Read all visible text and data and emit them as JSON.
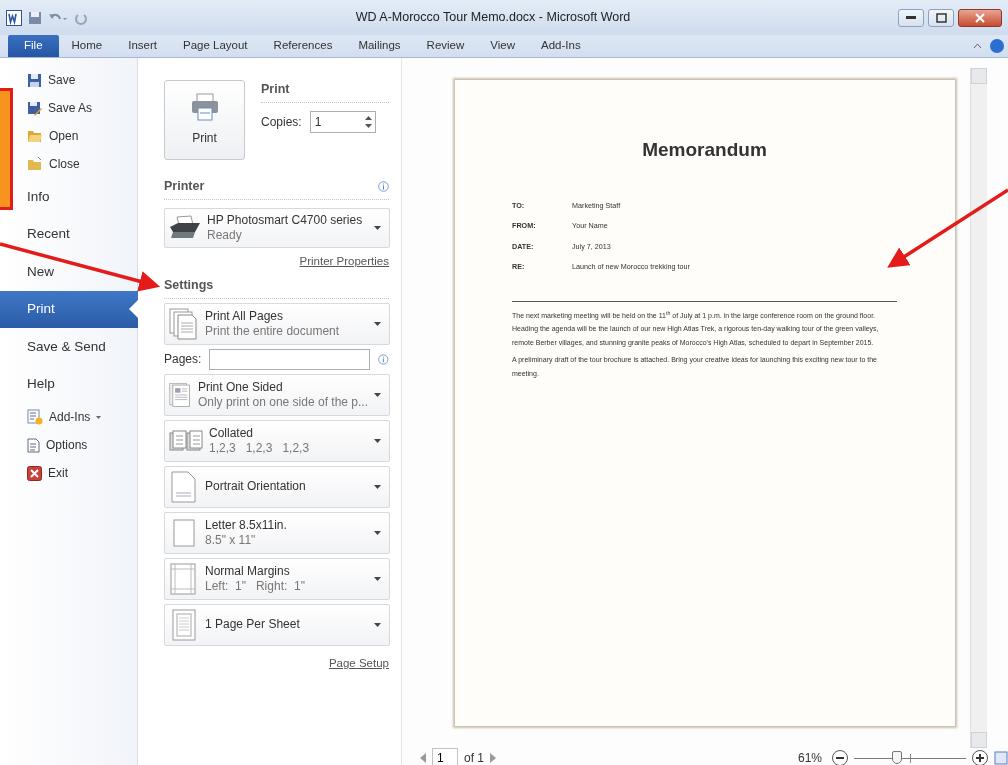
{
  "window": {
    "title": "WD A-Morocco Tour Memo.docx  -  Microsoft Word"
  },
  "ribbon_tabs": [
    {
      "label": "File",
      "selected": true
    },
    {
      "label": "Home",
      "selected": false
    },
    {
      "label": "Insert",
      "selected": false
    },
    {
      "label": "Page Layout",
      "selected": false
    },
    {
      "label": "References",
      "selected": false
    },
    {
      "label": "Mailings",
      "selected": false
    },
    {
      "label": "Review",
      "selected": false
    },
    {
      "label": "View",
      "selected": false
    },
    {
      "label": "Add-Ins",
      "selected": false
    }
  ],
  "backstage_menu": [
    {
      "label": "Save",
      "kind": "command",
      "selected": false
    },
    {
      "label": "Save As",
      "kind": "command",
      "selected": false
    },
    {
      "label": "Open",
      "kind": "command",
      "selected": false
    },
    {
      "label": "Close",
      "kind": "command",
      "selected": false
    },
    {
      "label": "Info",
      "kind": "section",
      "selected": false
    },
    {
      "label": "Recent",
      "kind": "section",
      "selected": false
    },
    {
      "label": "New",
      "kind": "section",
      "selected": false
    },
    {
      "label": "Print",
      "kind": "section",
      "selected": true
    },
    {
      "label": "Save & Send",
      "kind": "section",
      "selected": false
    },
    {
      "label": "Help",
      "kind": "section",
      "selected": false
    },
    {
      "label": "Add-Ins",
      "kind": "menu",
      "selected": false
    },
    {
      "label": "Options",
      "kind": "command",
      "selected": false
    },
    {
      "label": "Exit",
      "kind": "command",
      "selected": false
    }
  ],
  "print": {
    "button_label": "Print",
    "heading": "Print",
    "copies_label": "Copies:",
    "copies_value": "1"
  },
  "printer": {
    "heading": "Printer",
    "name": "HP Photosmart C4700 series",
    "status": "Ready",
    "properties_link": "Printer Properties"
  },
  "settings": {
    "heading": "Settings",
    "page_setup_link": "Page Setup",
    "items": [
      {
        "kind": "dropdown",
        "title": "Print All Pages",
        "subtitle": "Print the entire document"
      },
      {
        "kind": "pages_field",
        "label": "Pages:"
      },
      {
        "kind": "dropdown",
        "title": "Print One Sided",
        "subtitle": "Only print on one side of the p..."
      },
      {
        "kind": "dropdown",
        "title": "Collated",
        "subtitle": "1,2,3   1,2,3   1,2,3"
      },
      {
        "kind": "dropdown",
        "title": "Portrait Orientation"
      },
      {
        "kind": "dropdown",
        "title": "Letter 8.5x11in.",
        "subtitle": "8.5\" x 11\""
      },
      {
        "kind": "dropdown",
        "title": "Normal Margins",
        "subtitle": "Left:  1\"   Right:  1\""
      },
      {
        "kind": "dropdown",
        "title": "1 Page Per Sheet"
      }
    ]
  },
  "document": {
    "title": "Memorandum",
    "fields": [
      {
        "label": "TO:",
        "value": "Marketing Staff"
      },
      {
        "label": "FROM:",
        "value": "Your Name"
      },
      {
        "label": "DATE:",
        "value": "July 7, 2013"
      },
      {
        "label": "RE:",
        "value": "Launch of new Morocco trekking tour"
      }
    ],
    "paragraphs": [
      "The next marketing meeting will be held on the 11$^{th}$ of July at 1 p.m. in the large conference room on the ground floor. Heading the agenda will be the launch of our new High Atlas Trek, a rigorous ten-day walking tour of the green valleys, remote Berber villages, and stunning granite peaks of Morocco's High Atlas, scheduled to depart in September 2015.",
      "A preliminary draft of the tour brochure is attached. Bring your creative ideas for launching this exciting new tour to the meeting."
    ]
  },
  "navigation": {
    "page": "1",
    "of": "of 1"
  },
  "zoom": {
    "percent": "61%",
    "level": 0.38
  }
}
